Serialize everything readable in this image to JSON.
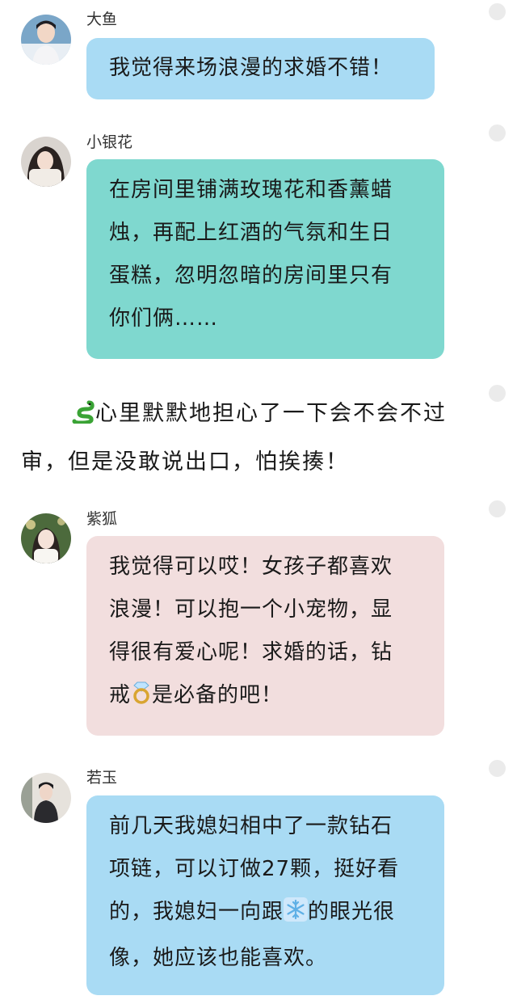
{
  "colors": {
    "bubble_blue": "#a9dbf4",
    "bubble_teal": "#7fd8cf",
    "bubble_pink": "#f2dede",
    "dot": "#ebebeb"
  },
  "messages": [
    {
      "sender": "大鱼",
      "lines": [
        "我觉得来场浪漫的求婚不错！"
      ]
    },
    {
      "sender": "小银花",
      "lines": [
        "在房间里铺满玫瑰花和香薰蜡",
        "烛，再配上红酒的气氛和生日",
        "蛋糕，忽明忽暗的房间里只有",
        "你们俩……"
      ]
    },
    {
      "sender": "紫狐",
      "lines": [
        "我觉得可以哎！女孩子都喜欢",
        "浪漫！可以抱一个小宠物，显",
        "得很有爱心呢！求婚的话，钻"
      ],
      "line4_a": "戒",
      "line4_b": "是必备的吧！"
    },
    {
      "sender": "若玉",
      "lines": [
        "前几天我媳妇相中了一款钻石",
        "项链，可以订做27颗，挺好看"
      ],
      "line3_a": "的，我媳妇一向跟",
      "line3_b": "的眼光很",
      "line4": "像，她应该也能喜欢。"
    }
  ],
  "narration": {
    "line1": "心里默默地担心了一下会不会不过",
    "line2": "审，但是没敢说出口，怕挨揍！"
  },
  "icons": [
    "snake-emoji",
    "ring-emoji",
    "snowflake-emoji"
  ]
}
